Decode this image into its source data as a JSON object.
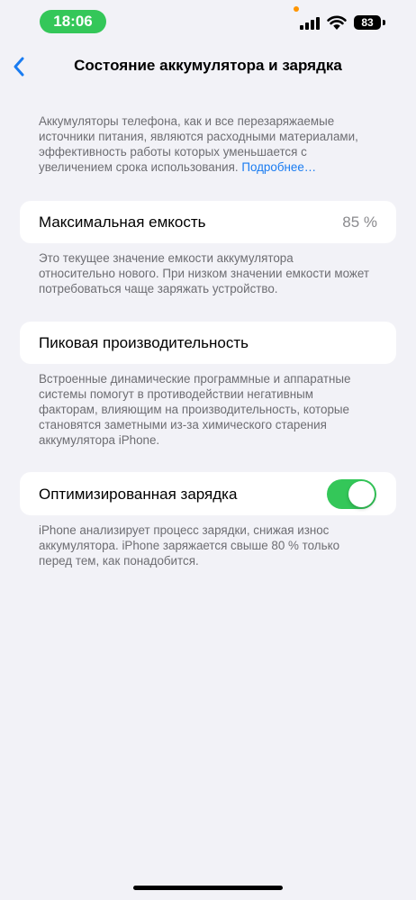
{
  "status_bar": {
    "time": "18:06",
    "battery": "83",
    "accent_color": "#34c759",
    "privacy_dot_color": "#ff9500",
    "icons": [
      "signal-icon",
      "wifi-icon",
      "battery-icon"
    ]
  },
  "nav": {
    "title": "Состояние аккумулятора и зарядка",
    "back_icon": "chevron-left-icon"
  },
  "intro": {
    "text": "Аккумуляторы телефона, как и все перезаряжаемые источники питания, являются расходными материалами, эффективность работы которых уменьшается с увеличением срока использования. ",
    "link": "Подробнее…"
  },
  "max_capacity": {
    "label": "Максимальная емкость",
    "value": "85 %",
    "note": "Это текущее значение емкости аккумулятора относительно нового. При низком значении емкости может потребоваться чаще заряжать устройство."
  },
  "peak_performance": {
    "label": "Пиковая производительность",
    "note": "Встроенные динамические программные и аппаратные системы помогут в противодействии негативным факторам, влияющим на производительность, которые становятся заметными из-за химического старения аккумулятора iPhone."
  },
  "optimized_charging": {
    "label": "Оптимизированная зарядка",
    "enabled": true,
    "note": "iPhone анализирует процесс зарядки, снижая износ аккумулятора. iPhone заряжается свыше 80 % только перед тем, как понадобится."
  }
}
